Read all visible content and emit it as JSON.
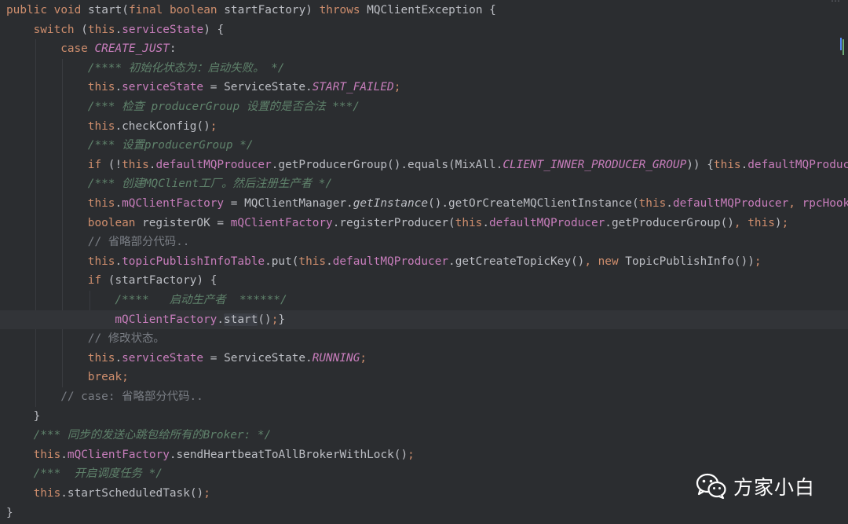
{
  "editor": {
    "theme": {
      "background": "#2b2d30",
      "current_line": "#323438",
      "keyword": "#cf8e6d",
      "field": "#c77dbb",
      "comment": "#7a7e85",
      "doc_comment": "#5f826b",
      "text": "#bcbec4"
    },
    "current_line_index": 16,
    "lines": [
      {
        "indent": 0,
        "segs": [
          [
            "kw",
            "public "
          ],
          [
            "kw",
            "void "
          ],
          [
            "plain",
            "start("
          ],
          [
            "kw",
            "final "
          ],
          [
            "kw",
            "boolean "
          ],
          [
            "plain",
            "startFactory) "
          ],
          [
            "kw",
            "throws "
          ],
          [
            "plain",
            "MQClientException {"
          ]
        ]
      },
      {
        "indent": 1,
        "segs": [
          [
            "kw",
            "switch "
          ],
          [
            "plain",
            "("
          ],
          [
            "kw",
            "this"
          ],
          [
            "plain",
            "."
          ],
          [
            "fld",
            "serviceState"
          ],
          [
            "plain",
            ") {"
          ]
        ]
      },
      {
        "indent": 2,
        "segs": [
          [
            "kw",
            "case "
          ],
          [
            "cst",
            "CREATE_JUST"
          ],
          [
            "plain",
            ":"
          ]
        ]
      },
      {
        "indent": 3,
        "segs": [
          [
            "doc",
            "/**** 初始化状态为：启动失败。 */"
          ]
        ]
      },
      {
        "indent": 3,
        "segs": [
          [
            "kw",
            "this"
          ],
          [
            "plain",
            "."
          ],
          [
            "fld",
            "serviceState"
          ],
          [
            "plain",
            " = ServiceState."
          ],
          [
            "cst",
            "START_FAILED"
          ],
          [
            "kw",
            ";"
          ]
        ]
      },
      {
        "indent": 3,
        "segs": [
          [
            "doc",
            "/*** 检查 producerGroup 设置的是否合法 ***/"
          ]
        ]
      },
      {
        "indent": 3,
        "segs": [
          [
            "kw",
            "this"
          ],
          [
            "plain",
            ".checkConfig()"
          ],
          [
            "kw",
            ";"
          ]
        ]
      },
      {
        "indent": 3,
        "segs": [
          [
            "doc",
            "/*** 设置producerGroup */"
          ]
        ]
      },
      {
        "indent": 3,
        "segs": [
          [
            "kw",
            "if "
          ],
          [
            "plain",
            "(!"
          ],
          [
            "kw",
            "this"
          ],
          [
            "plain",
            "."
          ],
          [
            "fld",
            "defaultMQProducer"
          ],
          [
            "plain",
            ".getProducerGroup().equals(MixAll."
          ],
          [
            "cst",
            "CLIENT_INNER_PRODUCER_GROUP"
          ],
          [
            "plain",
            ")) {"
          ],
          [
            "kw",
            "this"
          ],
          [
            "plain",
            "."
          ],
          [
            "fld",
            "defaultMQProducer"
          ]
        ]
      },
      {
        "indent": 3,
        "segs": [
          [
            "doc",
            "/*** 创建MQClient工厂。然后注册生产者 */"
          ]
        ]
      },
      {
        "indent": 3,
        "segs": [
          [
            "kw",
            "this"
          ],
          [
            "plain",
            "."
          ],
          [
            "fld",
            "mQClientFactory"
          ],
          [
            "plain",
            " = MQClientManager."
          ],
          [
            "stat",
            "getInstance"
          ],
          [
            "plain",
            "().getOrCreateMQClientInstance("
          ],
          [
            "kw",
            "this"
          ],
          [
            "plain",
            "."
          ],
          [
            "fld",
            "defaultMQProducer"
          ],
          [
            "kw",
            ", "
          ],
          [
            "fld",
            "rpcHook"
          ]
        ]
      },
      {
        "indent": 3,
        "segs": [
          [
            "kw",
            "boolean "
          ],
          [
            "plain",
            "registerOK = "
          ],
          [
            "fld",
            "mQClientFactory"
          ],
          [
            "plain",
            ".registerProducer("
          ],
          [
            "kw",
            "this"
          ],
          [
            "plain",
            "."
          ],
          [
            "fld",
            "defaultMQProducer"
          ],
          [
            "plain",
            ".getProducerGroup()"
          ],
          [
            "kw",
            ", this"
          ],
          [
            "plain",
            ")"
          ],
          [
            "kw",
            ";"
          ]
        ]
      },
      {
        "indent": 3,
        "segs": [
          [
            "cmt",
            "// 省略部分代码.."
          ]
        ]
      },
      {
        "indent": 3,
        "segs": [
          [
            "kw",
            "this"
          ],
          [
            "plain",
            "."
          ],
          [
            "fld",
            "topicPublishInfoTable"
          ],
          [
            "plain",
            ".put("
          ],
          [
            "kw",
            "this"
          ],
          [
            "plain",
            "."
          ],
          [
            "fld",
            "defaultMQProducer"
          ],
          [
            "plain",
            ".getCreateTopicKey()"
          ],
          [
            "kw",
            ", new "
          ],
          [
            "plain",
            "TopicPublishInfo())"
          ],
          [
            "kw",
            ";"
          ]
        ]
      },
      {
        "indent": 3,
        "segs": [
          [
            "kw",
            "if "
          ],
          [
            "plain",
            "(startFactory) {"
          ]
        ]
      },
      {
        "indent": 4,
        "segs": [
          [
            "doc",
            "/****   启动生产者  ******/"
          ]
        ]
      },
      {
        "indent": 4,
        "segs": [
          [
            "fld",
            "mQClientFactory"
          ],
          [
            "plain",
            "."
          ],
          [
            "hl",
            "start"
          ],
          [
            "plain",
            "()"
          ],
          [
            "kw",
            ";"
          ],
          [
            "plain",
            "}"
          ]
        ]
      },
      {
        "indent": 3,
        "segs": [
          [
            "cmt",
            "// 修改状态。"
          ]
        ]
      },
      {
        "indent": 3,
        "segs": [
          [
            "kw",
            "this"
          ],
          [
            "plain",
            "."
          ],
          [
            "fld",
            "serviceState"
          ],
          [
            "plain",
            " = ServiceState."
          ],
          [
            "cst",
            "RUNNING"
          ],
          [
            "kw",
            ";"
          ]
        ]
      },
      {
        "indent": 3,
        "segs": [
          [
            "kw",
            "break;"
          ]
        ]
      },
      {
        "indent": 2,
        "segs": [
          [
            "cmt",
            "// case: 省略部分代码.."
          ]
        ]
      },
      {
        "indent": 1,
        "segs": [
          [
            "plain",
            "}"
          ]
        ]
      },
      {
        "indent": 1,
        "segs": [
          [
            "doc",
            "/*** 同步的发送心跳包给所有的Broker: */"
          ]
        ]
      },
      {
        "indent": 1,
        "segs": [
          [
            "kw",
            "this"
          ],
          [
            "plain",
            "."
          ],
          [
            "fld",
            "mQClientFactory"
          ],
          [
            "plain",
            ".sendHeartbeatToAllBrokerWithLock()"
          ],
          [
            "kw",
            ";"
          ]
        ]
      },
      {
        "indent": 1,
        "segs": [
          [
            "doc",
            "/***  开启调度任务 */"
          ]
        ]
      },
      {
        "indent": 1,
        "segs": [
          [
            "kw",
            "this"
          ],
          [
            "plain",
            ".startScheduledTask()"
          ],
          [
            "kw",
            ";"
          ]
        ]
      },
      {
        "indent": 0,
        "segs": [
          [
            "plain",
            "}"
          ]
        ]
      }
    ]
  },
  "watermark": {
    "text": "方家小白",
    "icon": "wechat-icon",
    "color": "#ffffff"
  }
}
